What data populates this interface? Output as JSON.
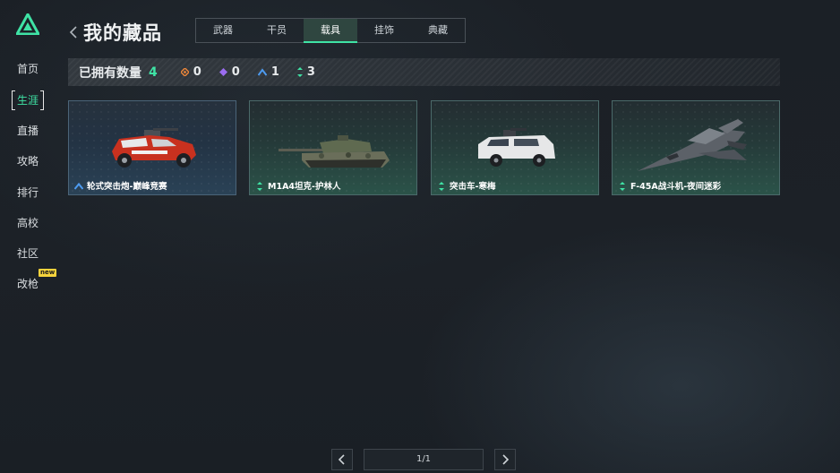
{
  "sidebar": {
    "items": [
      {
        "label": "首页"
      },
      {
        "label": "生涯"
      },
      {
        "label": "直播"
      },
      {
        "label": "攻略"
      },
      {
        "label": "排行"
      },
      {
        "label": "高校"
      },
      {
        "label": "社区"
      },
      {
        "label": "改枪",
        "badge": "new"
      }
    ],
    "active_index": 1
  },
  "header": {
    "title": "我的藏品",
    "tabs": [
      "武器",
      "干员",
      "载具",
      "挂饰",
      "典藏"
    ],
    "active_tab_index": 2
  },
  "stats": {
    "label": "已拥有数量",
    "total": "4",
    "counts": [
      {
        "icon": "orange-diamond-icon",
        "color": "#e7843a",
        "value": "0"
      },
      {
        "icon": "purple-diamond-icon",
        "color": "#9a6cf0",
        "value": "0"
      },
      {
        "icon": "blue-chevron-icon",
        "color": "#4d9bf0",
        "value": "1"
      },
      {
        "icon": "green-arrows-icon",
        "color": "#3fe3a5",
        "value": "3"
      }
    ]
  },
  "cards": [
    {
      "name": "轮式突击炮-巅峰竞赛",
      "rarity": "blue",
      "vehicle_icon": "armored-car-icon"
    },
    {
      "name": "M1A4坦克-护林人",
      "rarity": "green",
      "vehicle_icon": "tank-icon"
    },
    {
      "name": "突击车-寒梅",
      "rarity": "green",
      "vehicle_icon": "assault-vehicle-icon"
    },
    {
      "name": "F-45A战斗机-夜间迷彩",
      "rarity": "green",
      "vehicle_icon": "fighter-jet-icon"
    }
  ],
  "pagination": {
    "label": "1/1"
  },
  "colors": {
    "accent": "#3fe3a5",
    "badge": "#f6d33c"
  }
}
